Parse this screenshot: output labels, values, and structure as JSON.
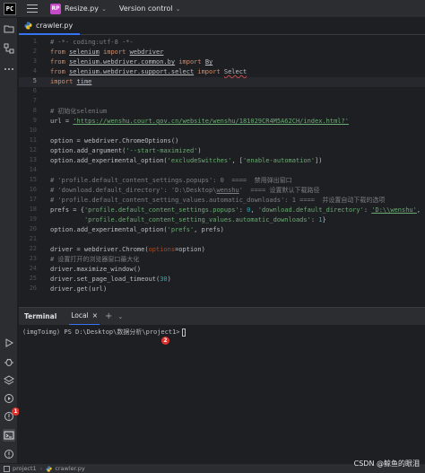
{
  "titlebar": {
    "app_logo_text": "PC",
    "project_badge": "RP",
    "project_badge_color": "#c54ac8",
    "project_name": "Resize.py",
    "project_chevron": "⌄",
    "vcs_label": "Version control",
    "vcs_chevron": "⌄"
  },
  "left_toolbar": {
    "top_icons": [
      "folder-icon",
      "structure-icon",
      "more-icon"
    ],
    "bottom_icons": [
      "run-icon",
      "debug-icon",
      "layers-icon",
      "services-icon",
      "problems-icon",
      "terminal-icon",
      "alert-icon",
      "git-icon"
    ]
  },
  "editor_tab": {
    "label": "crawler.py"
  },
  "editor": {
    "current_line": 5,
    "lines": [
      {
        "n": "1",
        "segs": [
          {
            "t": "# -*- coding:utf-8 -*-",
            "c": "cm"
          }
        ]
      },
      {
        "n": "2",
        "segs": [
          {
            "t": "from ",
            "c": "kw"
          },
          {
            "t": "selenium",
            "c": "u"
          },
          {
            "t": " import ",
            "c": "kw"
          },
          {
            "t": "webdriver",
            "c": "u"
          }
        ]
      },
      {
        "n": "3",
        "segs": [
          {
            "t": "from ",
            "c": "kw"
          },
          {
            "t": "selenium.webdriver.common.by",
            "c": "u"
          },
          {
            "t": " import ",
            "c": "kw"
          },
          {
            "t": "By",
            "c": "u"
          }
        ]
      },
      {
        "n": "4",
        "segs": [
          {
            "t": "from ",
            "c": "kw"
          },
          {
            "t": "selenium.webdriver.support.select",
            "c": "u"
          },
          {
            "t": " import ",
            "c": "kw"
          },
          {
            "t": "Select",
            "c": "wavy"
          }
        ]
      },
      {
        "n": "5",
        "segs": [
          {
            "t": "import ",
            "c": "kw"
          },
          {
            "t": "time",
            "c": "u"
          }
        ]
      },
      {
        "n": "6",
        "segs": []
      },
      {
        "n": "7",
        "segs": []
      },
      {
        "n": "8",
        "segs": [
          {
            "t": "# 初始化selenium",
            "c": "cm"
          }
        ]
      },
      {
        "n": "9",
        "segs": [
          {
            "t": "url = "
          },
          {
            "t": "'https://wenshu.court.gov.cn/website/wenshu/181029CR4M5A62CH/index.html?'",
            "c": "str u"
          }
        ]
      },
      {
        "n": "10",
        "segs": []
      },
      {
        "n": "11",
        "segs": [
          {
            "t": "option = webdriver.ChromeOptions()"
          }
        ]
      },
      {
        "n": "12",
        "segs": [
          {
            "t": "option.add_argument("
          },
          {
            "t": "'--start-maximized'",
            "c": "str"
          },
          {
            "t": ")"
          }
        ]
      },
      {
        "n": "13",
        "segs": [
          {
            "t": "option.add_experimental_option("
          },
          {
            "t": "'excludeSwitches'",
            "c": "str"
          },
          {
            "t": ", ["
          },
          {
            "t": "'enable-automation'",
            "c": "str"
          },
          {
            "t": "])"
          }
        ]
      },
      {
        "n": "14",
        "segs": []
      },
      {
        "n": "15",
        "segs": [
          {
            "t": "# 'profile.default_content_settings.popups': 0  ====  禁用弹出窗口",
            "c": "cm"
          }
        ]
      },
      {
        "n": "16",
        "segs": [
          {
            "t": "# 'download.default_directory': 'D:\\Desktop\\",
            "c": "cm"
          },
          {
            "t": "wenshu",
            "c": "cm u"
          },
          {
            "t": "'  ==== 设置默认下载路径",
            "c": "cm"
          }
        ]
      },
      {
        "n": "17",
        "segs": [
          {
            "t": "# 'profile.default_content_setting_values.automatic_downloads': 1 ====  并设置自动下载的选项",
            "c": "cm"
          }
        ]
      },
      {
        "n": "18",
        "segs": [
          {
            "t": "prefs = {"
          },
          {
            "t": "'profile.default_content_settings.popups'",
            "c": "str"
          },
          {
            "t": ": "
          },
          {
            "t": "0",
            "c": "num"
          },
          {
            "t": ", "
          },
          {
            "t": "'download.default_directory'",
            "c": "str"
          },
          {
            "t": ": "
          },
          {
            "t": "'D:\\\\wenshu'",
            "c": "str u"
          },
          {
            "t": ","
          }
        ]
      },
      {
        "n": "19",
        "segs": [
          {
            "t": "         "
          },
          {
            "t": "'profile.default_content_setting_values.automatic_downloads'",
            "c": "str"
          },
          {
            "t": ": "
          },
          {
            "t": "1",
            "c": "num"
          },
          {
            "t": "}"
          }
        ]
      },
      {
        "n": "20",
        "segs": [
          {
            "t": "option.add_experimental_option("
          },
          {
            "t": "'prefs'",
            "c": "str"
          },
          {
            "t": ", prefs)"
          }
        ]
      },
      {
        "n": "21",
        "segs": []
      },
      {
        "n": "22",
        "segs": [
          {
            "t": "driver = webdriver.Chrome("
          },
          {
            "t": "options",
            "c": "param"
          },
          {
            "t": "=option)"
          }
        ]
      },
      {
        "n": "23",
        "segs": [
          {
            "t": "# 设置打开的浏览器窗口最大化",
            "c": "cm"
          }
        ]
      },
      {
        "n": "24",
        "segs": [
          {
            "t": "driver.maximize_window()"
          }
        ]
      },
      {
        "n": "25",
        "segs": [
          {
            "t": "driver.set_page_load_timeout("
          },
          {
            "t": "30",
            "c": "num"
          },
          {
            "t": ")"
          }
        ]
      },
      {
        "n": "26",
        "segs": [
          {
            "t": "driver.get(url)"
          }
        ]
      }
    ]
  },
  "terminal": {
    "title": "Terminal",
    "tab_label": "Local",
    "close_glyph": "×",
    "add_glyph": "+",
    "more_glyph": "⌄",
    "prompt": "(imgToimg) PS D:\\Desktop\\数据分析\\project1>",
    "annotation_number": "2"
  },
  "sidebar_badge": "1",
  "statusbar": {
    "project": "project1",
    "separator": "›",
    "file": "crawler.py"
  },
  "watermark": "CSDN @鲸鱼的眼泪",
  "colors": {
    "accent": "#3574f0",
    "badge_red": "#e0312d"
  }
}
